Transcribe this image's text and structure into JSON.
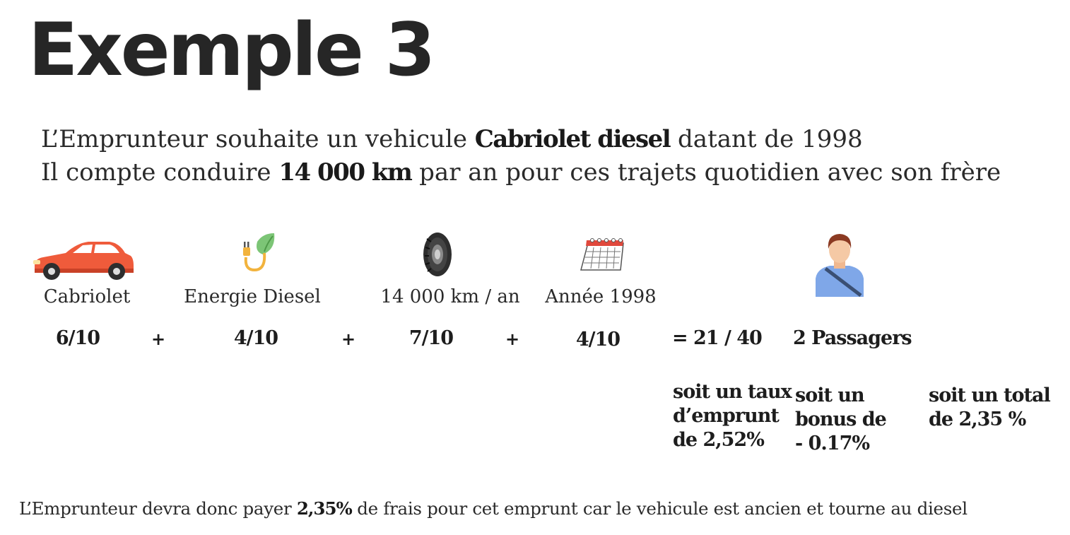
{
  "title": "Exemple 3",
  "intro": {
    "line1": {
      "before": "L’Emprunteur souhaite un vehicule ",
      "bold": "Cabriolet diesel",
      "after": " datant de 1998"
    },
    "line2": {
      "before": "Il compte conduire ",
      "bold": "14 000 km",
      "after": " par an pour ces trajets quotidien avec son frère"
    }
  },
  "criteria": [
    {
      "icon": "car-icon",
      "label": "Cabriolet",
      "score": "6/10"
    },
    {
      "icon": "electric-plug-leaf-icon",
      "label": "Energie Diesel",
      "score": "4/10"
    },
    {
      "icon": "tire-icon",
      "label": "14 000 km / an",
      "score": "7/10"
    },
    {
      "icon": "calendar-icon",
      "label": "Année 1998",
      "score": "4/10"
    }
  ],
  "operators": {
    "plus": "+"
  },
  "total_score": "= 21 / 40",
  "passengers": {
    "icon": "person-with-seatbelt-icon",
    "label": "2 Passagers"
  },
  "results": {
    "rate": [
      "soit un taux",
      "d’emprunt",
      "de 2,52%"
    ],
    "bonus": [
      "soit un",
      "bonus de",
      "- 0.17%"
    ],
    "total": [
      "soit un total",
      "de 2,35 %"
    ]
  },
  "footer": {
    "before": "L’Emprunteur devra donc payer ",
    "bold": "2,35%",
    "after": " de frais pour cet emprunt car le vehicule est ancien et tourne au diesel"
  },
  "colors": {
    "car": "#ef5b3b",
    "car_dark": "#c94127",
    "leaf": "#7cc576",
    "plug_cable": "#f2b33d",
    "tire": "#2e2e2e",
    "calendar_red": "#e0483c",
    "person_shirt": "#7fa7e8",
    "person_hair": "#8b3a22",
    "person_skin": "#f5c9a5"
  }
}
